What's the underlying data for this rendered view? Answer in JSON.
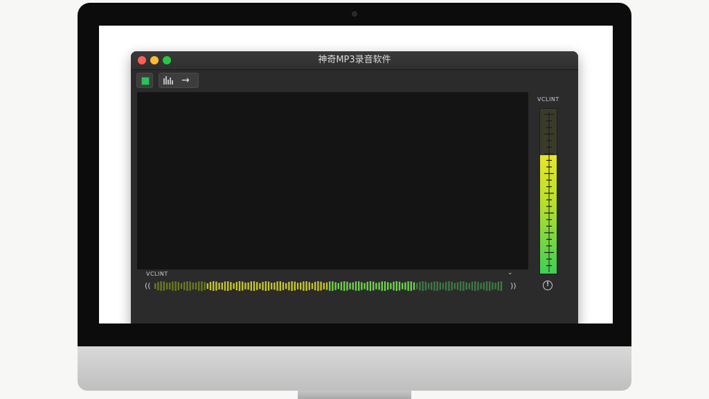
{
  "window": {
    "title": "神奇MP3录音软件"
  },
  "toolbar": {
    "record_icon": "record-square-icon",
    "bars_icon": "waveform-bars-icon",
    "arrow_icon": "arrow-right-icon",
    "arrow_glyph": "→"
  },
  "bottom": {
    "label": "VCLINT",
    "chevron": "⌄",
    "left_glyph": "((",
    "right_glyph": "))"
  },
  "meter": {
    "label": "VCLINT",
    "level": 0.72,
    "icon_glyph": "!"
  },
  "colors": {
    "wave_start": "#27b84a",
    "wave_end": "#c4dd2c",
    "meter_top": "#e8e628",
    "meter_bottom": "#3fcf55"
  }
}
